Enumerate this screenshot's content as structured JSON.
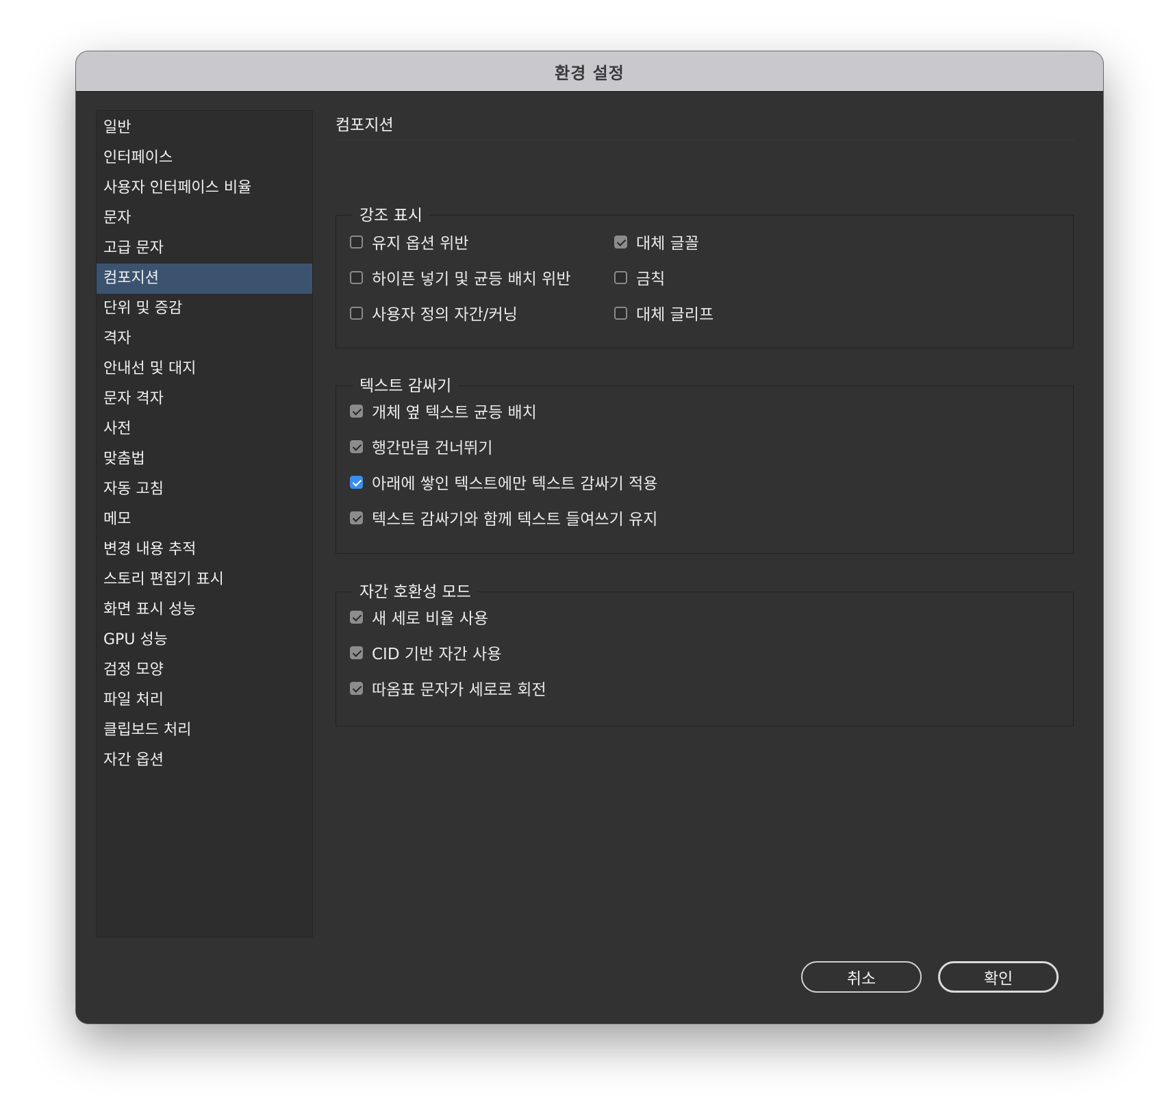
{
  "window": {
    "title": "환경 설정"
  },
  "sidebar": {
    "items": [
      {
        "label": "일반"
      },
      {
        "label": "인터페이스"
      },
      {
        "label": "사용자 인터페이스 비율"
      },
      {
        "label": "문자"
      },
      {
        "label": "고급 문자"
      },
      {
        "label": "컴포지션",
        "selected": true
      },
      {
        "label": "단위 및 증감"
      },
      {
        "label": "격자"
      },
      {
        "label": "안내선 및 대지"
      },
      {
        "label": "문자 격자"
      },
      {
        "label": "사전"
      },
      {
        "label": "맞춤법"
      },
      {
        "label": "자동 고침"
      },
      {
        "label": "메모"
      },
      {
        "label": "변경 내용 추적"
      },
      {
        "label": "스토리 편집기 표시"
      },
      {
        "label": "화면 표시 성능"
      },
      {
        "label": "GPU 성능"
      },
      {
        "label": "검정 모양"
      },
      {
        "label": "파일 처리"
      },
      {
        "label": "클립보드 처리"
      },
      {
        "label": "자간 옵션"
      }
    ]
  },
  "main": {
    "heading": "컴포지션",
    "highlight": {
      "title": "강조 표시",
      "options": [
        {
          "label": "유지 옵션 위반",
          "checked": false
        },
        {
          "label": "대체 글꼴",
          "checked": true
        },
        {
          "label": "하이픈 넣기 및 균등 배치 위반",
          "checked": false
        },
        {
          "label": "금칙",
          "checked": false
        },
        {
          "label": "사용자 정의 자간/커닝",
          "checked": false
        },
        {
          "label": "대체 글리프",
          "checked": false
        }
      ]
    },
    "text_wrap": {
      "title": "텍스트 감싸기",
      "options": [
        {
          "label": "개체 옆 텍스트 균등 배치",
          "checked": true
        },
        {
          "label": "행간만큼 건너뛰기",
          "checked": true
        },
        {
          "label": "아래에 쌓인 텍스트에만 텍스트 감싸기 적용",
          "checked": true,
          "focused": true
        },
        {
          "label": "텍스트 감싸기와 함께 텍스트 들여쓰기 유지",
          "checked": true
        }
      ]
    },
    "mojikumi": {
      "title": "자간 호환성 모드",
      "options": [
        {
          "label": "새 세로 비율 사용",
          "checked": true
        },
        {
          "label": "CID 기반 자간 사용",
          "checked": true
        },
        {
          "label": "따옴표 문자가 세로로 회전",
          "checked": true
        }
      ]
    }
  },
  "buttons": {
    "cancel": "취소",
    "ok": "확인"
  },
  "colors": {
    "window_bg": "#323232",
    "titlebar_bg": "#c9c8cc",
    "selection": "#3c5370",
    "accent_checkbox": "#3a8ef0"
  }
}
